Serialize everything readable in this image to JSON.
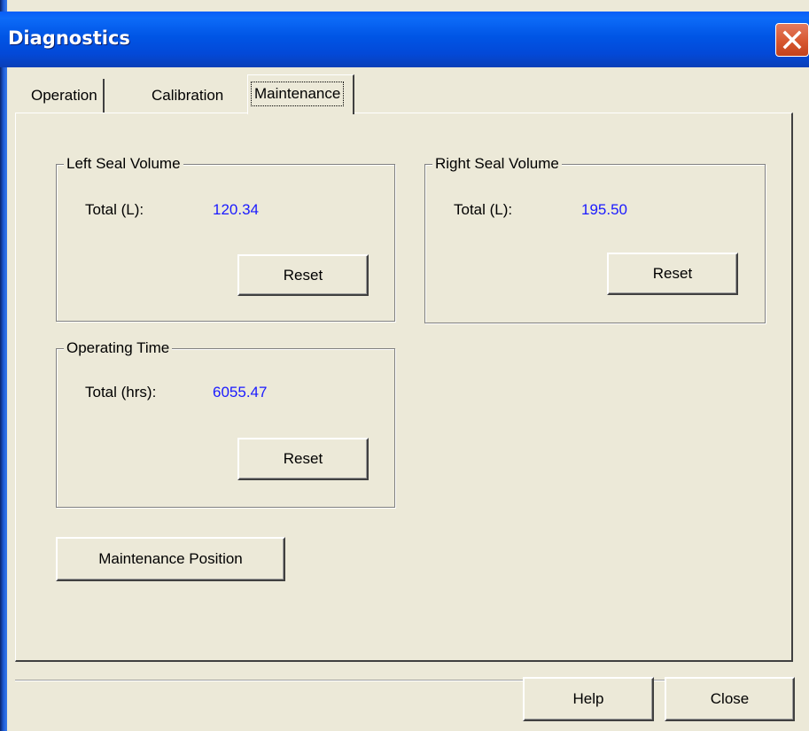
{
  "window": {
    "title": "Diagnostics"
  },
  "tabs": [
    {
      "label": "Operation"
    },
    {
      "label": "Calibration"
    },
    {
      "label": "Maintenance"
    }
  ],
  "left_seal": {
    "title": "Left Seal Volume",
    "total_label": "Total (L):",
    "total_value": "120.34",
    "reset_label": "Reset"
  },
  "right_seal": {
    "title": "Right Seal Volume",
    "total_label": "Total (L):",
    "total_value": "195.50",
    "reset_label": "Reset"
  },
  "operating_time": {
    "title": "Operating Time",
    "total_label": "Total (hrs):",
    "total_value": "6055.47",
    "reset_label": "Reset"
  },
  "maintenance_position_label": "Maintenance Position",
  "footer": {
    "help_label": "Help",
    "close_label": "Close"
  },
  "icons": {
    "close": "close-icon"
  },
  "colors": {
    "value_text": "#1a1aff",
    "titlebar": "#0055e5",
    "close_button": "#d7572f",
    "dialog_bg": "#ece9d8"
  }
}
